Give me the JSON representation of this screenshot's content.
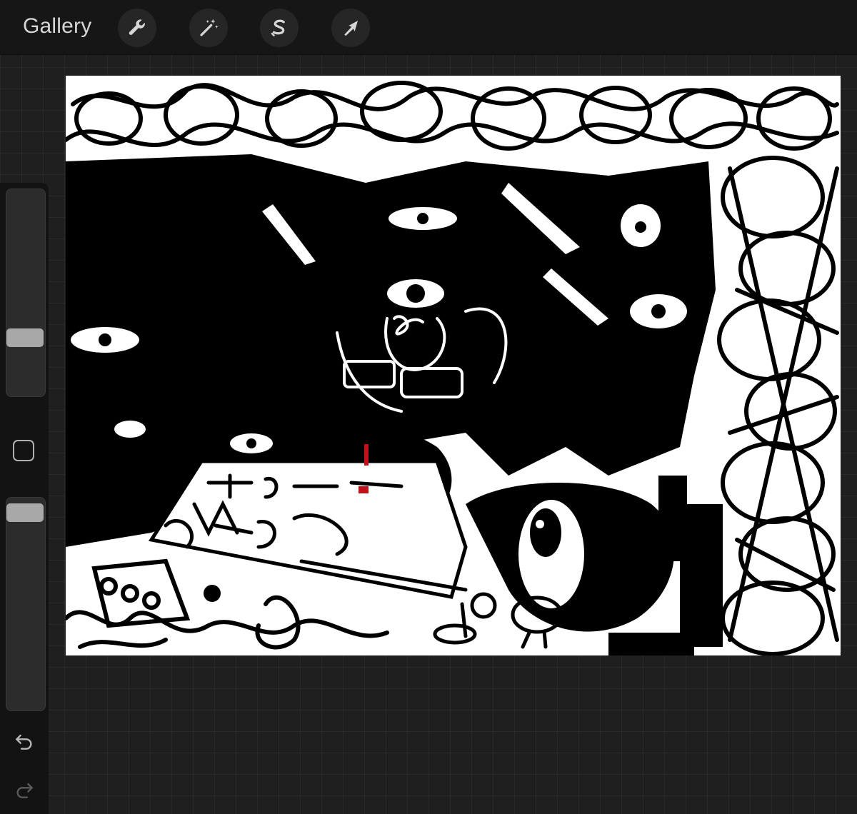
{
  "header": {
    "gallery_label": "Gallery",
    "tools": [
      {
        "name": "actions",
        "icon": "wrench-icon"
      },
      {
        "name": "adjustments",
        "icon": "magic-wand-icon"
      },
      {
        "name": "selection",
        "icon": "selection-s-icon"
      },
      {
        "name": "transform",
        "icon": "arrow-cursor-icon"
      }
    ]
  },
  "sidebar": {
    "brush_size_level": 0.38,
    "opacity_level": 0.95,
    "modify_button": "square-icon",
    "undo_icon": "undo-icon",
    "redo_icon": "redo-icon"
  },
  "canvas": {
    "description_icon": "artwork-canvas",
    "colors": {
      "ink": "#000000",
      "paper": "#ffffff",
      "accent": "#c0101a"
    }
  },
  "colors": {
    "topbar_bg": "#161616",
    "workspace_bg": "#1f1f1f",
    "sidebar_bg": "#131313",
    "icon_color": "#d6d6d6"
  }
}
